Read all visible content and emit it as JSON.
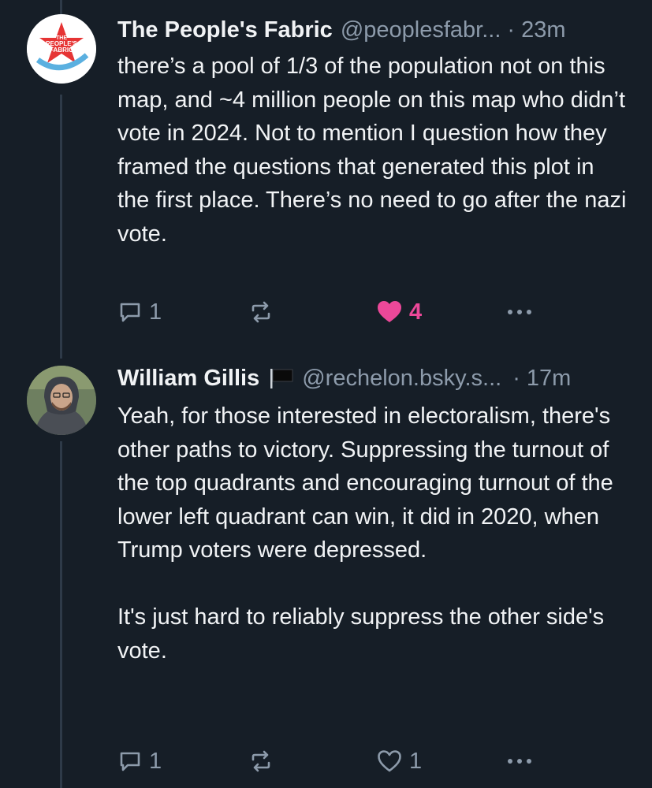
{
  "posts": [
    {
      "author": "The People's Fabric",
      "handle": "@peoplesfabr...",
      "separator": "·",
      "time": "23m",
      "avatar": {
        "icon": "peoples-fabric-logo",
        "text": "THE PEOPLE'S FABRIC",
        "colors": {
          "star": "#e63434",
          "band": "#5bb0e0"
        }
      },
      "text": "there’s a pool of 1/3 of the population not on this map, and ~4 million people on this map who didn’t vote in 2024. Not to mention I question how they framed the questions that generated this plot in the first place. There’s no need to go after the nazi vote.",
      "replies": "1",
      "reposts": "",
      "likes": "4",
      "liked": true
    },
    {
      "author": "William Gillis",
      "flag_icon": "black-flag-icon",
      "handle": "@rechelon.bsky.s...",
      "separator": "·",
      "time": "17m",
      "text": "Yeah, for those interested in electoralism, there's other paths to victory. Suppressing the turnout of the top quadrants and encouraging turnout of the lower left quadrant can win, it did in 2020, when Trump voters were depressed.",
      "text2": "It's just hard to reliably suppress the other side's vote.",
      "replies": "1",
      "reposts": "",
      "likes": "1",
      "liked": false
    }
  ],
  "colors": {
    "background": "#161e27",
    "accent_like": "#ec4899",
    "muted": "#8d9bab"
  }
}
